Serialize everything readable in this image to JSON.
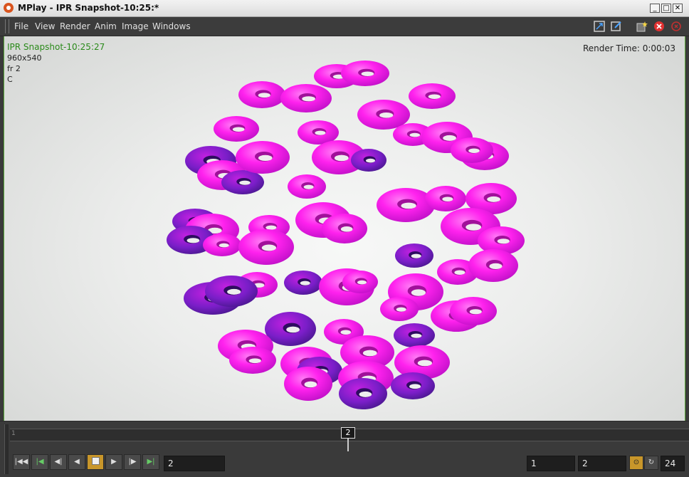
{
  "window": {
    "title": "MPlay - IPR Snapshot-10:25:*"
  },
  "menu": {
    "items": [
      "File",
      "View",
      "Render",
      "Anim",
      "Image",
      "Windows"
    ]
  },
  "viewport": {
    "snapshot_name": "IPR Snapshot-10:25:27",
    "resolution": "960x540",
    "frame_info": "fr 2",
    "channel": "C",
    "render_time": "Render Time: 0:00:03"
  },
  "timeline": {
    "start_label": "1",
    "current_frame_marker": "2",
    "current_frame_field": "2",
    "range_start": "1",
    "range_end": "2",
    "fps": "24"
  },
  "colors": {
    "torus_main": "#ff22ee",
    "torus_shadow": "#5a20b0",
    "viewport_border": "#5aaa3a",
    "active_button": "#c8962a"
  },
  "icons": {
    "playback": [
      "jump-to-start-icon",
      "step-to-first-key-icon",
      "step-back-icon",
      "play-backward-icon",
      "stop-icon",
      "play-forward-icon",
      "step-forward-icon",
      "jump-to-end-icon"
    ]
  }
}
